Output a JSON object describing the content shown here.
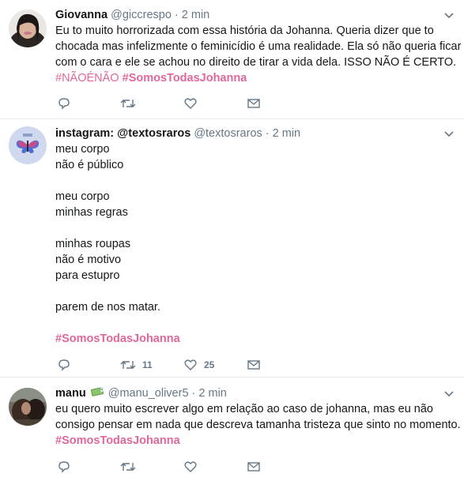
{
  "tweets": [
    {
      "name": "Giovanna",
      "handle": "@giccrespo",
      "time": "· 2 min",
      "lines": [
        "Eu to muito horrorizada com essa história da Johanna. Queria dizer que to",
        "chocada mas infelizmente o feminicídio é uma realidade. Ela só não queria ficar",
        "com o cara e ele se achou no direito de tirar a vida dela. ISSO NÃO É CERTO."
      ],
      "hashtag_1": "#NÃOÉNÃO",
      "hashtag_2": "#SomosTodasJohanna",
      "retweets": "",
      "likes": ""
    },
    {
      "name": "instagram: @textosraros",
      "handle": "@textosraros",
      "time": "· 2 min",
      "lines": [
        "meu corpo",
        "não é público",
        "",
        "meu corpo",
        "minhas regras",
        "",
        "minhas roupas",
        "não é motivo",
        "para estupro",
        "",
        "parem de nos matar.",
        ""
      ],
      "hashtag_1": "#SomosTodasJohanna",
      "retweets": "11",
      "likes": "25"
    },
    {
      "name": "manu",
      "handle": "@manu_oliver5",
      "time": "· 2 min",
      "lines": [
        "eu quero muito escrever algo em relação ao caso de johanna, mas eu não",
        "consigo pensar em nada que descreva tamanha tristeza que sinto no momento."
      ],
      "hashtag_1": "#SomosTodasJohanna",
      "retweets": "",
      "likes": ""
    }
  ],
  "colors": {
    "hashtag": "#e0679b",
    "secondary_text": "#657786",
    "divider": "#e6ecf0"
  },
  "icons": [
    "reply-icon",
    "retweet-icon",
    "like-icon",
    "message-icon",
    "chevron-down-icon",
    "money-emoji-icon"
  ]
}
